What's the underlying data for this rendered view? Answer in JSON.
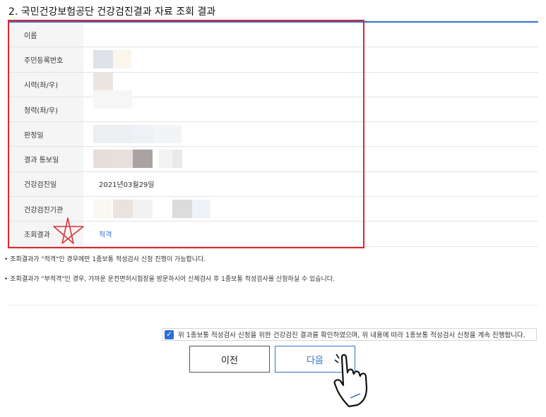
{
  "section_title": "2. 국민건강보험공단 건강검진결과 자료 조회 결과",
  "rows": [
    {
      "label": "이름",
      "value": ""
    },
    {
      "label": "주민등록번호",
      "value": ""
    },
    {
      "label": "시력(좌/우)",
      "value": ""
    },
    {
      "label": "청력(좌/우)",
      "value": ""
    },
    {
      "label": "판정일",
      "value": ""
    },
    {
      "label": "결과 통보일",
      "value": ""
    },
    {
      "label": "건강검진일",
      "value": "2021년03월29일"
    },
    {
      "label": "건강검진기관",
      "value": ""
    },
    {
      "label": "조회결과",
      "value": "적격"
    }
  ],
  "notes": [
    "• 조회결과가 \"적격\"인 경우에만 1종보통 적성검사 신청 진행이 가능합니다.",
    "• 조회결과가 \"부적격\"인 경우, 가까운 운전면허시험장을 방문하시어 신체검사 후 1종보통 적성검사를 신청하실 수 있습니다."
  ],
  "consent": {
    "checked": true,
    "text": "위 1종보통 적성검사 신청을 위한 건강검진 결과를 확인하였으며, 위 내용에 따라 1종보통 적성검사 신청을 계속 진행합니다."
  },
  "buttons": {
    "prev": "이전",
    "next": "다음"
  },
  "colors": {
    "accent": "#2f6fd1",
    "highlight_box": "#e2232a"
  }
}
